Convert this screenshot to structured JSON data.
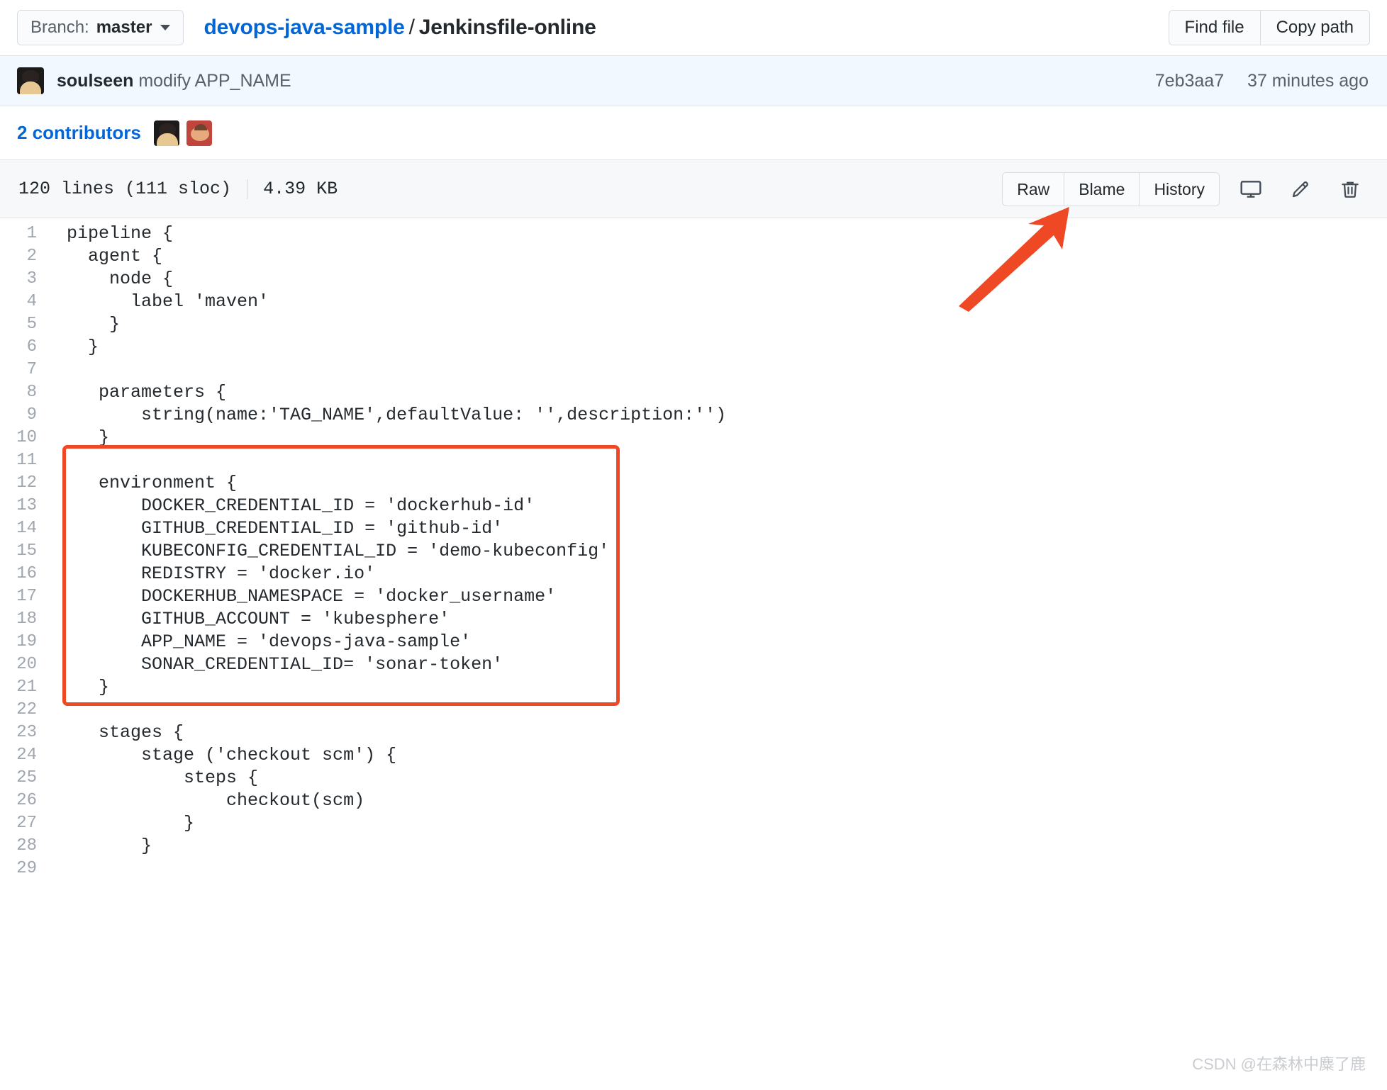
{
  "topbar": {
    "branch_label": "Branch:",
    "branch_value": "master",
    "repo_name": "devops-java-sample",
    "path_separator": "/",
    "file_name": "Jenkinsfile-online",
    "find_file_label": "Find file",
    "copy_path_label": "Copy path"
  },
  "commit": {
    "author": "soulseen",
    "message": "modify APP_NAME",
    "sha": "7eb3aa7",
    "time": "37 minutes ago"
  },
  "contributors": {
    "label": "2 contributors"
  },
  "filebar": {
    "lines": "120 lines (111 sloc)",
    "size": "4.39 KB",
    "raw_label": "Raw",
    "blame_label": "Blame",
    "history_label": "History",
    "desktop_icon": "desktop-icon",
    "edit_icon": "pencil-icon",
    "delete_icon": "trash-icon"
  },
  "code": {
    "lines": [
      {
        "n": "1",
        "t": "pipeline {"
      },
      {
        "n": "2",
        "t": "  agent {"
      },
      {
        "n": "3",
        "t": "    node {"
      },
      {
        "n": "4",
        "t": "      label 'maven'"
      },
      {
        "n": "5",
        "t": "    }"
      },
      {
        "n": "6",
        "t": "  }"
      },
      {
        "n": "7",
        "t": ""
      },
      {
        "n": "8",
        "t": "   parameters {"
      },
      {
        "n": "9",
        "t": "       string(name:'TAG_NAME',defaultValue: '',description:'')"
      },
      {
        "n": "10",
        "t": "   }"
      },
      {
        "n": "11",
        "t": ""
      },
      {
        "n": "12",
        "t": "   environment {"
      },
      {
        "n": "13",
        "t": "       DOCKER_CREDENTIAL_ID = 'dockerhub-id'"
      },
      {
        "n": "14",
        "t": "       GITHUB_CREDENTIAL_ID = 'github-id'"
      },
      {
        "n": "15",
        "t": "       KUBECONFIG_CREDENTIAL_ID = 'demo-kubeconfig'"
      },
      {
        "n": "16",
        "t": "       REDISTRY = 'docker.io'"
      },
      {
        "n": "17",
        "t": "       DOCKERHUB_NAMESPACE = 'docker_username'"
      },
      {
        "n": "18",
        "t": "       GITHUB_ACCOUNT = 'kubesphere'"
      },
      {
        "n": "19",
        "t": "       APP_NAME = 'devops-java-sample'"
      },
      {
        "n": "20",
        "t": "       SONAR_CREDENTIAL_ID= 'sonar-token'"
      },
      {
        "n": "21",
        "t": "   }"
      },
      {
        "n": "22",
        "t": ""
      },
      {
        "n": "23",
        "t": "   stages {"
      },
      {
        "n": "24",
        "t": "       stage ('checkout scm') {"
      },
      {
        "n": "25",
        "t": "           steps {"
      },
      {
        "n": "26",
        "t": "               checkout(scm)"
      },
      {
        "n": "27",
        "t": "           }"
      },
      {
        "n": "28",
        "t": "       }"
      },
      {
        "n": "29",
        "t": ""
      }
    ]
  },
  "annotations": {
    "highlight_color": "#ef4824",
    "arrow_color": "#ef4824",
    "watermark": "CSDN @在森林中麋了鹿"
  }
}
